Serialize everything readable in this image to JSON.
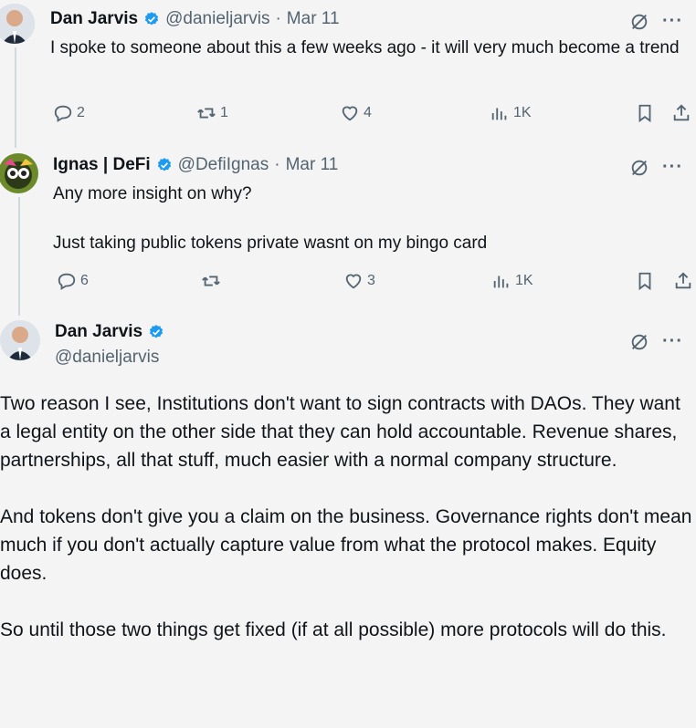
{
  "reply1": {
    "name": "Dan Jarvis",
    "handle": "@danieljarvis",
    "sep": "·",
    "date": "Mar 11",
    "text": "I spoke to someone about this a few weeks ago - it will very much become a trend",
    "replies": "2",
    "reposts": "1",
    "likes": "4",
    "views": "1K"
  },
  "reply2": {
    "name": "Ignas | DeFi",
    "handle": "@DefiIgnas",
    "sep": "·",
    "date": "Mar 11",
    "text_line1": "Any more insight on why?",
    "text_line2": "Just taking public tokens private wasnt on my bingo card",
    "replies": "6",
    "reposts": "",
    "likes": "3",
    "views": "1K"
  },
  "main": {
    "name": "Dan Jarvis",
    "handle": "@danieljarvis",
    "paragraphs": [
      "Two reason I see, Institutions don't want to sign contracts with DAOs. They want a legal entity on the other side that they can hold accountable. Revenue shares, partnerships, all that stuff, much easier with a normal company structure.",
      "And tokens don't give you a claim on the business. Governance rights don't mean much if you don't actually capture value from what the protocol makes. Equity does.",
      "So until those two things get fixed (if at all possible) more protocols will do this."
    ]
  },
  "colors": {
    "verified": "#1d9bf0",
    "secondary": "#536471",
    "thread": "#cfd9de"
  },
  "icons": [
    "reply-icon",
    "repost-icon",
    "like-icon",
    "views-icon",
    "bookmark-icon",
    "share-icon",
    "grok-icon",
    "more-icon",
    "verified-badge-icon"
  ]
}
